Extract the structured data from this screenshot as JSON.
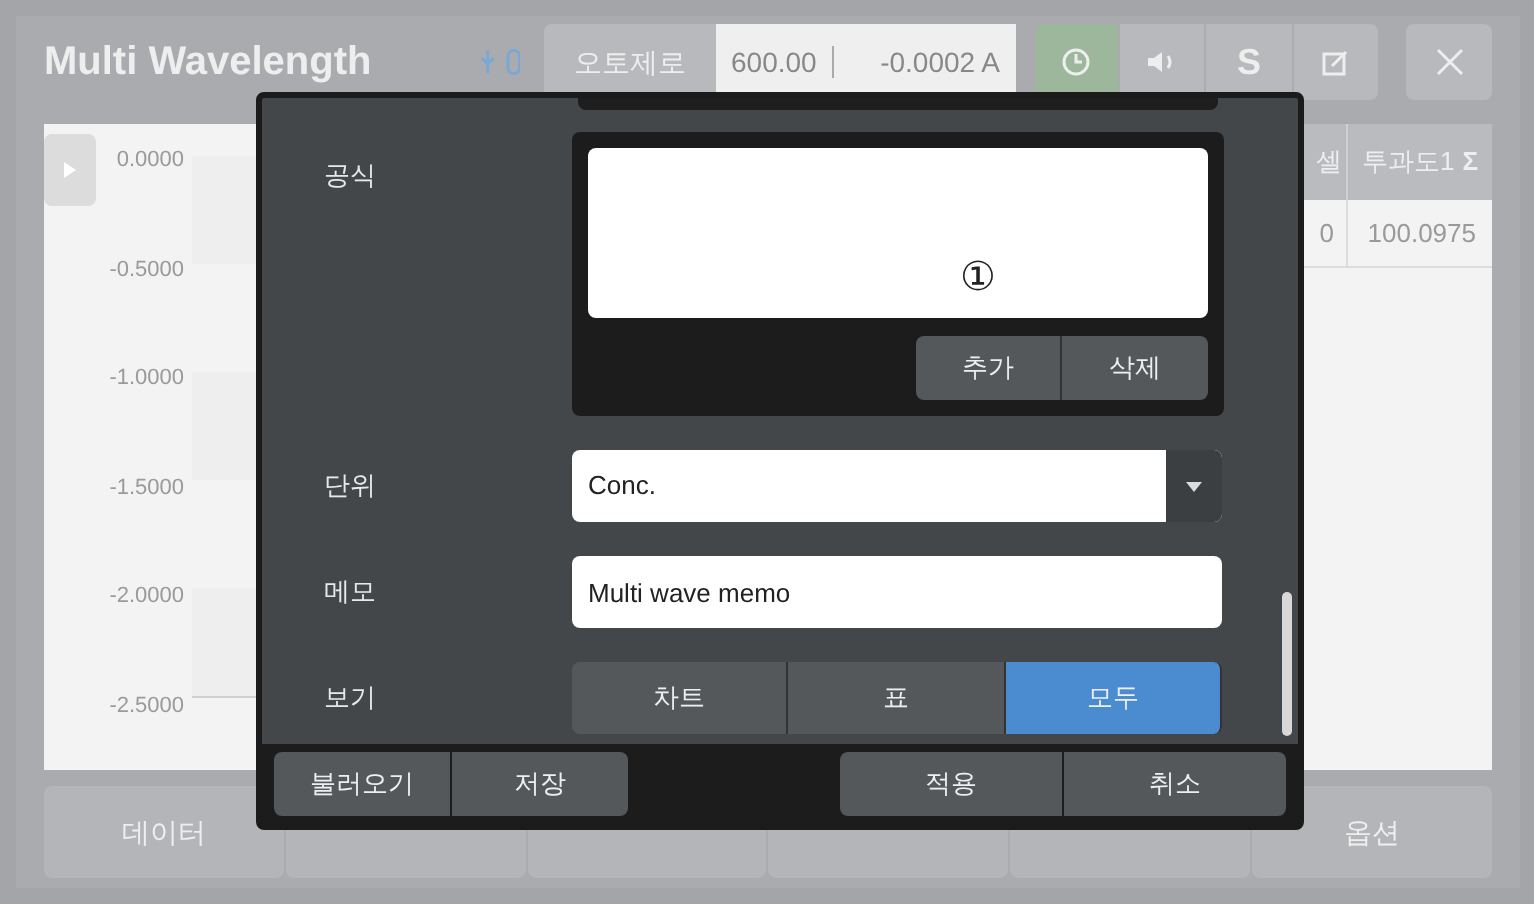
{
  "header": {
    "title": "Multi Wavelength",
    "autozero": "오토제로",
    "wavelength": "600.00",
    "reading": "-0.0002 A",
    "s_button": "S"
  },
  "chart": {
    "y_labels": [
      "0.0000",
      "-0.5000",
      "-1.0000",
      "-1.5000",
      "-2.0000",
      "-2.5000"
    ]
  },
  "table": {
    "columns": [
      "셀",
      "투과도1"
    ],
    "sigma": "Σ",
    "rows": [
      [
        "0",
        "100.0975"
      ]
    ]
  },
  "bottom_tabs": [
    {
      "label": "데이터"
    },
    {
      "label": "옵션"
    }
  ],
  "dialog": {
    "formula": {
      "label": "공식",
      "marker": "①",
      "buttons": [
        "추가",
        "삭제"
      ]
    },
    "unit": {
      "label": "단위",
      "value": "Conc."
    },
    "memo": {
      "label": "메모",
      "value": "Multi wave memo"
    },
    "view": {
      "label": "보기",
      "options": [
        {
          "label": "차트",
          "selected": false
        },
        {
          "label": "표",
          "selected": false
        },
        {
          "label": "모두",
          "selected": true
        }
      ]
    },
    "footer_left": [
      "불러오기",
      "저장"
    ],
    "footer_right": [
      "적용",
      "취소"
    ]
  }
}
